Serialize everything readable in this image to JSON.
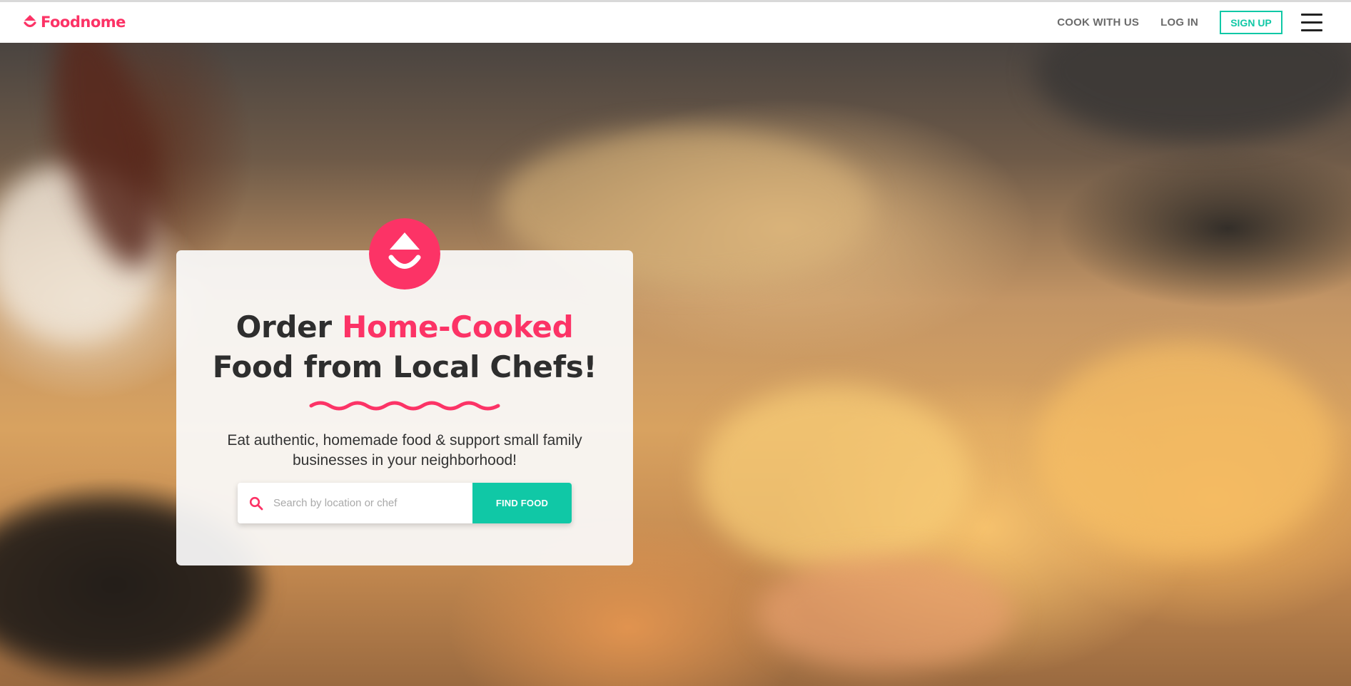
{
  "colors": {
    "brand": "#fc3366",
    "accent": "#10c8a6",
    "text_dark": "#2e2e2e"
  },
  "header": {
    "logo_text": "Foodnome",
    "nav": {
      "cook_with_us": "COOK WITH US",
      "log_in": "LOG IN",
      "sign_up": "SIGN UP"
    }
  },
  "hero": {
    "headline": {
      "part1": "Order ",
      "highlight": "Home-Cooked",
      "part2": "Food from Local Chefs!"
    },
    "subtext": "Eat authentic, homemade food & support small family businesses in your neighborhood!",
    "search": {
      "placeholder": "Search by location or chef",
      "value": "",
      "button_label": "FIND FOOD"
    }
  },
  "icons": {
    "logo": "foodnome-logo-icon",
    "search": "search-icon",
    "menu": "hamburger-menu-icon"
  }
}
